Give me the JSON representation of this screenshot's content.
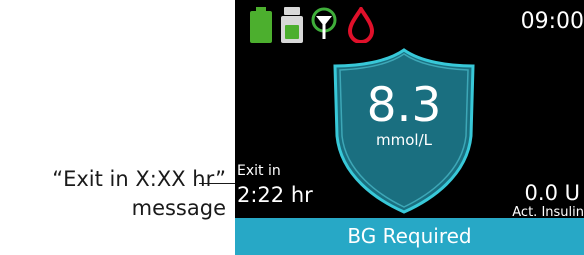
{
  "annotation": {
    "line1": "“Exit in X:XX hr”",
    "line2": "message"
  },
  "status_bar": {
    "icons": [
      "battery-icon",
      "insulin-cartridge-icon",
      "cgm-signal-icon",
      "blood-drop-icon"
    ],
    "time": "09:00"
  },
  "glucose": {
    "value": "8.3",
    "unit": "mmol/L"
  },
  "exit": {
    "label": "Exit in",
    "time": "2:22 hr"
  },
  "insulin": {
    "value": "0.0 U",
    "label": "Act. Insulin"
  },
  "banner": {
    "text": "BG Required"
  },
  "colors": {
    "battery": "#4caf2e",
    "signal": "#3fae3a",
    "drop": "#e0102a",
    "shield_fill": "#1a6f80",
    "shield_glow": "#38c8d8",
    "banner": "#27a8c6"
  }
}
